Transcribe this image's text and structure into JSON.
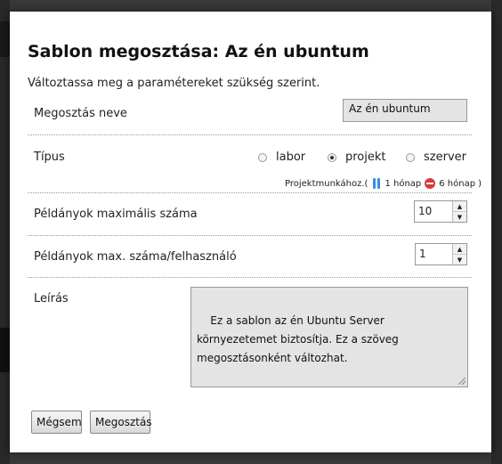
{
  "dialog": {
    "title": "Sablon megosztása: Az én ubuntum",
    "subtitle": "Változtassa meg a paramétereket szükség szerint."
  },
  "fields": {
    "share_name": {
      "label": "Megosztás neve",
      "value": "Az én ubuntum"
    },
    "type": {
      "label": "Típus",
      "options": [
        "labor",
        "projekt",
        "szerver"
      ],
      "selected": "projekt",
      "hint_prefix": "Projektmunkához.(",
      "hint_blue": "1 hónap",
      "hint_red": "6 hónap",
      "hint_suffix": ")"
    },
    "max_instances": {
      "label": "Példányok maximális száma",
      "value": "10"
    },
    "max_per_user": {
      "label": "Példányok max. száma/felhasználó",
      "value": "1"
    },
    "description": {
      "label": "Leírás",
      "value": "Ez a sablon az én Ubuntu Server környezetemet biztosítja. Ez a szöveg megosztásonként változhat."
    }
  },
  "buttons": {
    "cancel": "Mégsem",
    "share": "Megosztás"
  },
  "colors": {
    "overlay": "#3a3a3a",
    "blue_icon": "#3a8fd8",
    "red_icon": "#d63b3b"
  }
}
